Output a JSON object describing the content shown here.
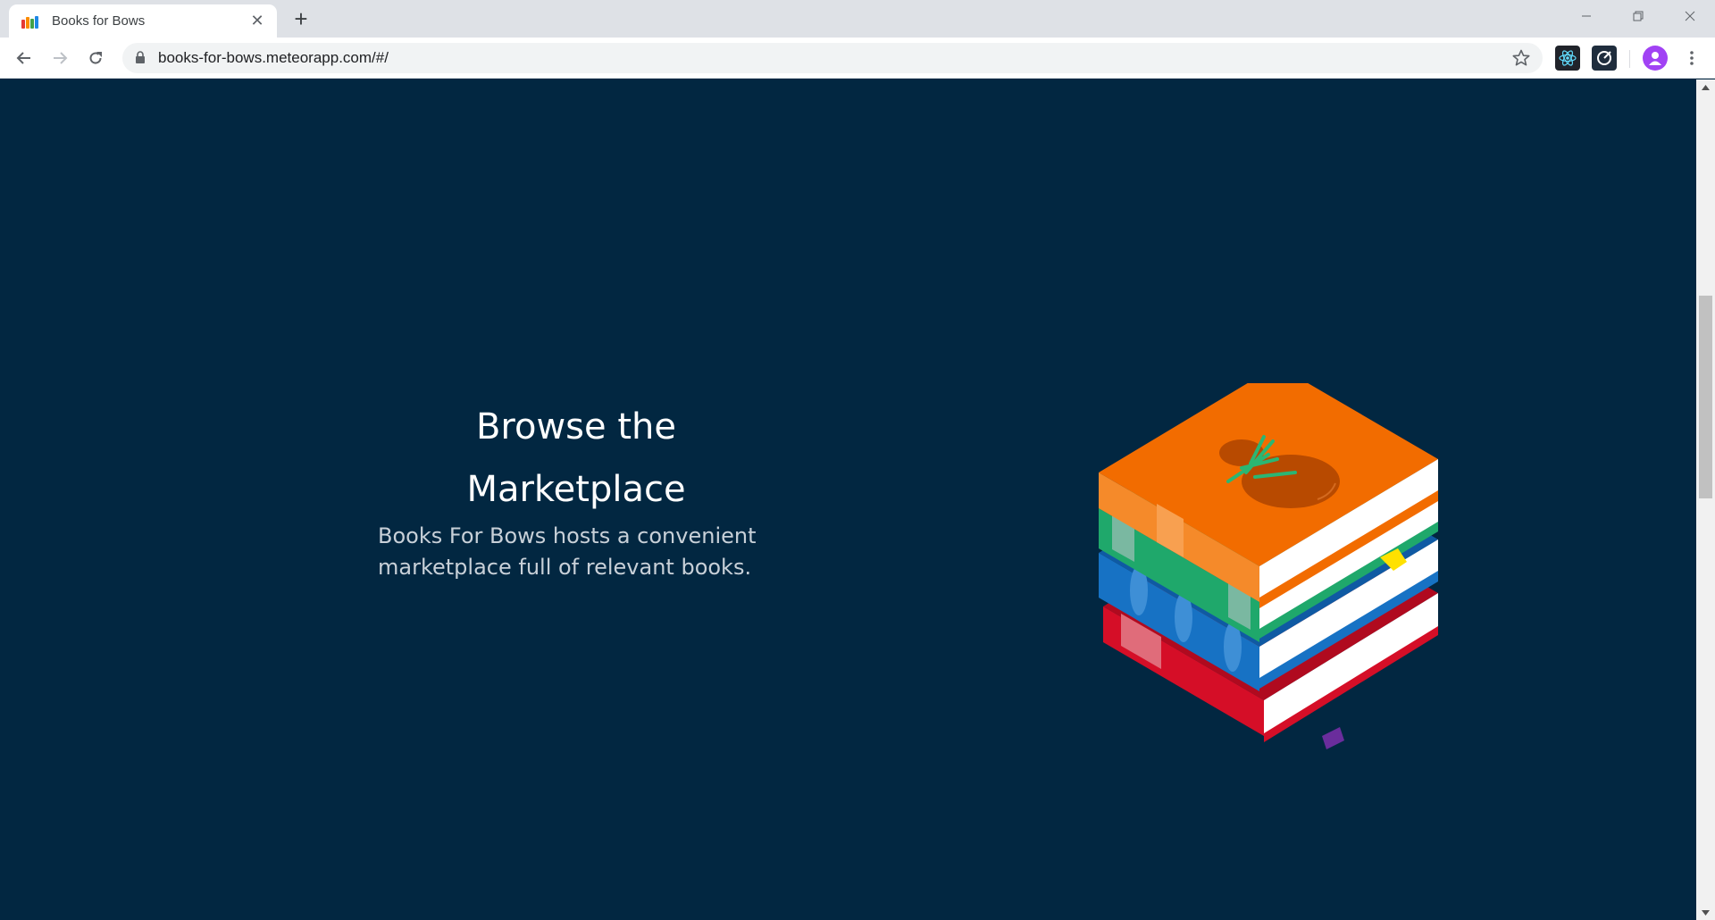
{
  "browser": {
    "tab_title": "Books for Bows",
    "url": "books-for-bows.meteorapp.com/#/",
    "new_tab_symbol": "+",
    "close_tab_symbol": "✕"
  },
  "hero": {
    "heading": "Browse the Marketplace",
    "description": "Books For Bows hosts a convenient marketplace full of relevant books."
  },
  "icons": {
    "favicon": "books-favicon",
    "illustration": "stacked-books-with-tomato-illustration"
  },
  "colors": {
    "page_background": "#022741",
    "heading_text": "#ffffff",
    "book_orange": "#f26c00",
    "book_green": "#1fa86b",
    "book_blue": "#1772c4",
    "book_red": "#d50e27"
  }
}
